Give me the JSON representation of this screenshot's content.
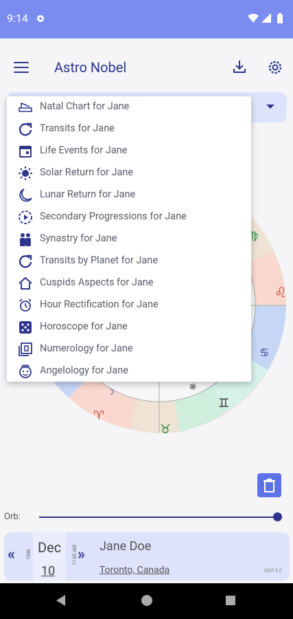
{
  "status": {
    "time": "9:14"
  },
  "app": {
    "title": "Astro Nobel"
  },
  "menu": [
    {
      "label": "Natal Chart for Jane",
      "icon": "natal-chart-icon"
    },
    {
      "label": "Transits for Jane",
      "icon": "refresh-icon"
    },
    {
      "label": "Life Events for Jane",
      "icon": "calendar-icon"
    },
    {
      "label": "Solar Return for Jane",
      "icon": "sun-icon"
    },
    {
      "label": "Lunar Return for Jane",
      "icon": "moon-icon"
    },
    {
      "label": "Secondary Progressions for Jane",
      "icon": "play-circle-icon"
    },
    {
      "label": "Synastry for Jane",
      "icon": "couple-icon"
    },
    {
      "label": "Transits by Planet for Jane",
      "icon": "refresh-icon"
    },
    {
      "label": "Cuspids Aspects for Jane",
      "icon": "house-icon"
    },
    {
      "label": "Hour Rectification for Jane",
      "icon": "alarm-clock-icon"
    },
    {
      "label": "Horoscope for Jane",
      "icon": "dice-icon"
    },
    {
      "label": "Numerology for Jane",
      "icon": "numerology-icon"
    },
    {
      "label": "Angelology for Jane",
      "icon": "angel-icon"
    }
  ],
  "orb": {
    "label": "Orb:",
    "value": 1.0
  },
  "person": {
    "year": "1986",
    "month": "Dec",
    "day": "10",
    "time": "11:00 AM",
    "name": "Jane Doe",
    "place": "Toronto, Canada",
    "gmt": "GMT-5.0"
  },
  "colors": {
    "accent": "#2d358f",
    "statusbar": "#7b8cf0",
    "card": "#dde3fb",
    "button": "#5b72e8"
  }
}
